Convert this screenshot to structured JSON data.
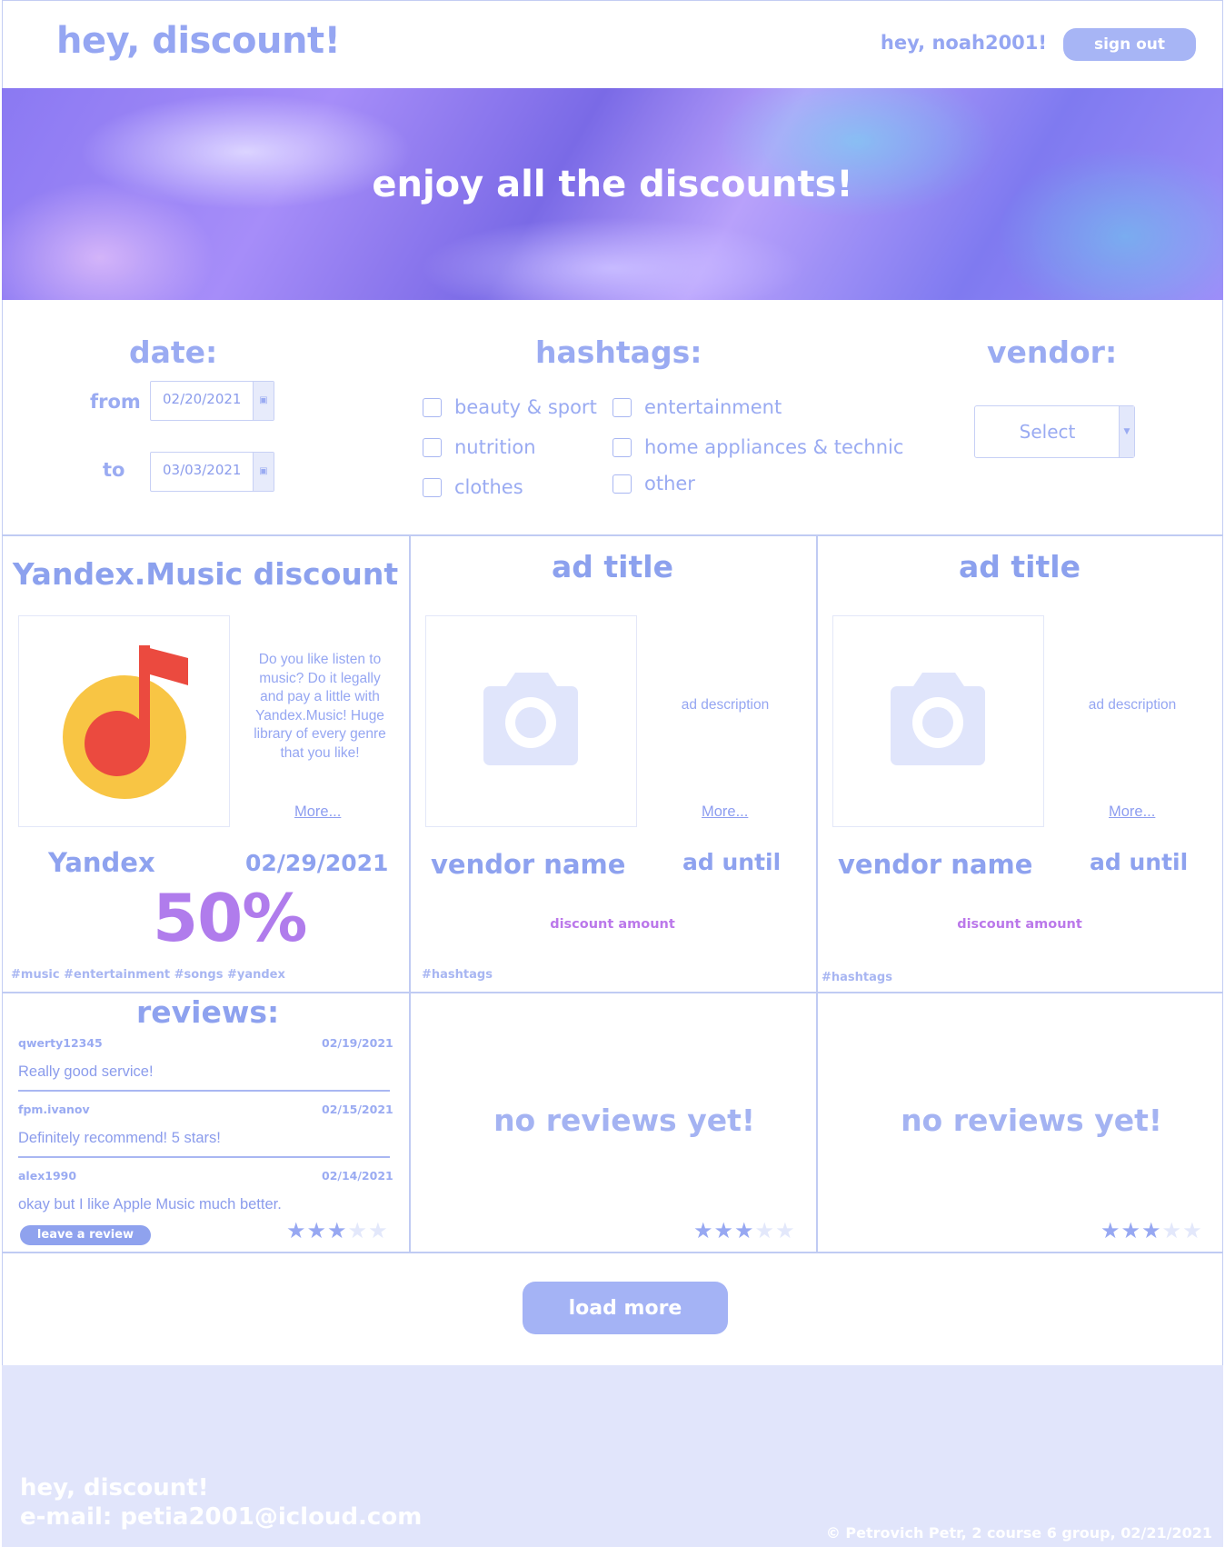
{
  "header": {
    "logo": "hey, discount!",
    "greeting": "hey, noah2001!",
    "sign_out": "sign out"
  },
  "hero": {
    "title": "enjoy all the discounts!"
  },
  "filters": {
    "date_heading": "date:",
    "from_label": "from",
    "from_value": "02/20/2021",
    "to_label": "to",
    "to_value": "03/03/2021",
    "hashtags_heading": "hashtags:",
    "hashtags": [
      "beauty & sport",
      "nutrition",
      "clothes",
      "entertainment",
      "home appliances & technic",
      "other"
    ],
    "vendor_heading": "vendor:",
    "vendor_select": "Select"
  },
  "cards": [
    {
      "title": "Yandex.Music discount",
      "description": "Do you like listen to music? Do it legally and pay a little with Yandex.Music! Huge library of every genre that you like!",
      "more": "More...",
      "vendor": "Yandex",
      "until": "02/29/2021",
      "amount": "50%",
      "hashtags": "#music #entertainment #songs #yandex",
      "image_icon": "yandex-music-logo"
    },
    {
      "title": "ad title",
      "description": "ad description",
      "more": "More...",
      "vendor": "vendor name",
      "until": "ad until",
      "amount": "discount amount",
      "hashtags": "#hashtags",
      "image_icon": "camera-icon"
    },
    {
      "title": "ad title",
      "description": "ad description",
      "more": "More...",
      "vendor": "vendor name",
      "until": "ad until",
      "amount": "discount amount",
      "hashtags": "#hashtags",
      "image_icon": "camera-icon"
    }
  ],
  "reviews": {
    "heading": "reviews:",
    "items": [
      {
        "user": "qwerty12345",
        "date": "02/19/2021",
        "text": "Really good service!"
      },
      {
        "user": "fpm.ivanov",
        "date": "02/15/2021",
        "text": "Definitely recommend! 5 stars!"
      },
      {
        "user": "alex1990",
        "date": "02/14/2021",
        "text": "okay but I like Apple Music much better."
      }
    ],
    "leave_review": "leave a review",
    "no_reviews": "no reviews yet!",
    "ratings": [
      3,
      3,
      3
    ],
    "max_rating": 5
  },
  "load_more": "load more",
  "footer": {
    "name": "hey, discount!",
    "email": "e-mail: petia2001@icloud.com",
    "copyright": "© Petrovich Petr, 2 course 6 group, 02/21/2021"
  },
  "colors": {
    "accent": "#8ea2ef",
    "accent_light": "#a7b5f5",
    "purple": "#b07cec",
    "footer_bg": "#e1e5fb"
  }
}
